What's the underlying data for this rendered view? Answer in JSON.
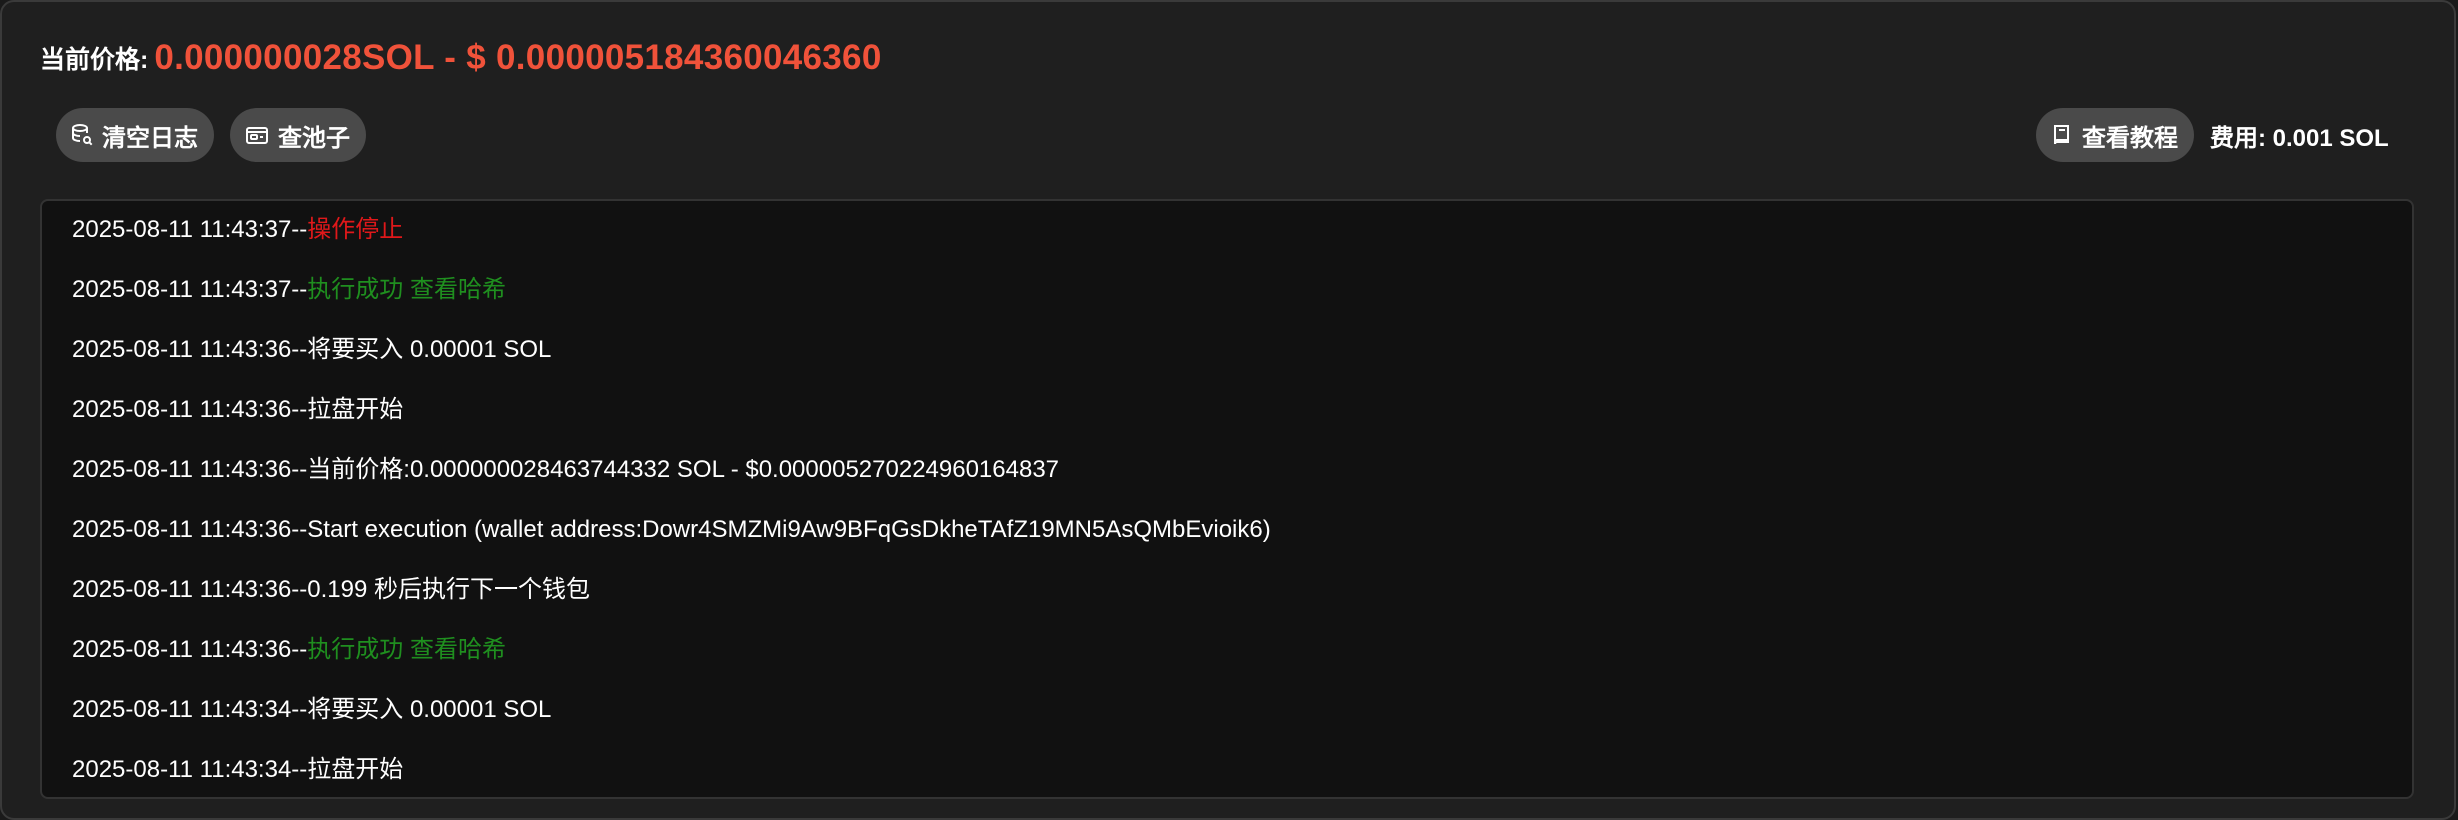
{
  "header": {
    "price_label": "当前价格:",
    "price_value": "0.000000028SOL - $ 0.000005184360046360"
  },
  "toolbar": {
    "clear_log_label": "清空日志",
    "check_pool_label": "查池子",
    "tutorial_label": "查看教程",
    "fee_label": "费用: 0.001 SOL"
  },
  "icons": {
    "clear_log": "database-search-icon",
    "check_pool": "wallet-icon",
    "tutorial": "book-icon"
  },
  "colors": {
    "price": "#f0523a",
    "error": "#e0181a",
    "success": "#1f8f1f",
    "text": "#ffffff"
  },
  "logs": [
    {
      "time": "2025-08-11 11:43:37--",
      "message": "操作停止",
      "status": "error",
      "link": ""
    },
    {
      "time": "2025-08-11 11:43:37--",
      "message": "执行成功",
      "status": "success",
      "link": "查看哈希"
    },
    {
      "time": "2025-08-11 11:43:36--",
      "message": "将要买入 0.00001 SOL",
      "status": "info",
      "link": ""
    },
    {
      "time": "2025-08-11 11:43:36--",
      "message": "拉盘开始",
      "status": "info",
      "link": ""
    },
    {
      "time": "2025-08-11 11:43:36--",
      "message": "当前价格:0.000000028463744332 SOL - $0.000005270224960164837",
      "status": "info",
      "link": ""
    },
    {
      "time": "2025-08-11 11:43:36--",
      "message": "Start execution (wallet address:Dowr4SMZMi9Aw9BFqGsDkheTAfZ19MN5AsQMbEvioik6)",
      "status": "info",
      "link": ""
    },
    {
      "time": "2025-08-11 11:43:36--",
      "message": "0.199 秒后执行下一个钱包",
      "status": "info",
      "link": ""
    },
    {
      "time": "2025-08-11 11:43:36--",
      "message": "执行成功",
      "status": "success",
      "link": "查看哈希"
    },
    {
      "time": "2025-08-11 11:43:34--",
      "message": "将要买入 0.00001 SOL",
      "status": "info",
      "link": ""
    },
    {
      "time": "2025-08-11 11:43:34--",
      "message": "拉盘开始",
      "status": "info",
      "link": ""
    }
  ]
}
